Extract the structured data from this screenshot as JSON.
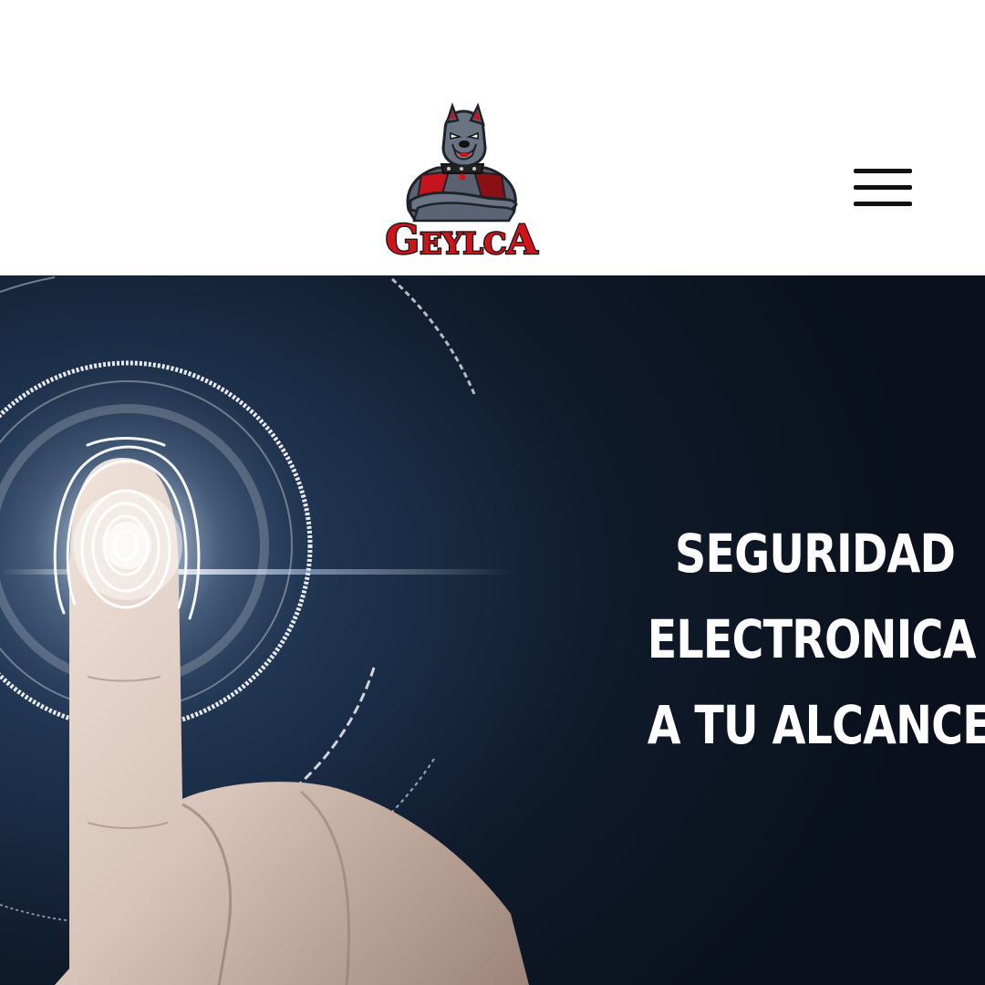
{
  "header": {
    "logo": {
      "brand_text": "GEYLCA",
      "icon": "pitbull-mascot-icon",
      "brand_color": "#d0121b"
    },
    "menu": {
      "icon": "hamburger-menu-icon"
    }
  },
  "hero": {
    "headline": {
      "line1": "SEGURIDAD",
      "line2": "ELECTRONICA",
      "line3": "A TU ALCANCE"
    },
    "background_image": "fingerprint-touch-scan",
    "colors": {
      "background": "#0f1a2a",
      "text": "#ffffff"
    }
  }
}
